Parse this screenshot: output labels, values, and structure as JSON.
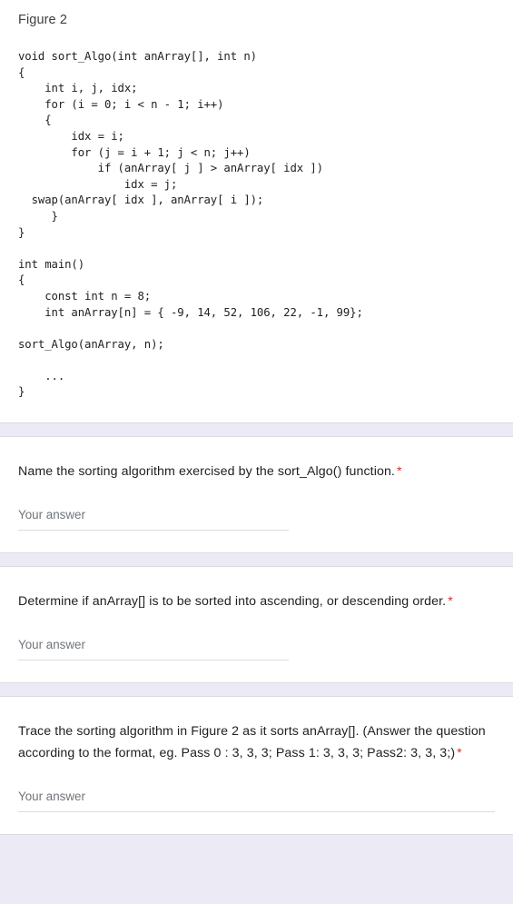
{
  "figure": {
    "title": "Figure 2",
    "code": "void sort_Algo(int anArray[], int n)\n{\n    int i, j, idx;\n    for (i = 0; i < n - 1; i++)\n    {\n        idx = i;\n        for (j = i + 1; j < n; j++)\n            if (anArray[ j ] > anArray[ idx ])\n                idx = j;\n  swap(anArray[ idx ], anArray[ i ]);\n     }\n}\n\nint main()\n{\n    const int n = 8;\n    int anArray[n] = { -9, 14, 52, 106, 22, -1, 99};\n\nsort_Algo(anArray, n);\n\n    ...\n}"
  },
  "questions": [
    {
      "text": "Name the sorting algorithm exercised by the sort_Algo() function.",
      "required_marker": "*",
      "answer_value": "",
      "answer_placeholder": "Your answer"
    },
    {
      "text": "Determine if anArray[] is to be sorted into ascending, or descending order.",
      "required_marker": "*",
      "answer_value": "",
      "answer_placeholder": "Your answer"
    },
    {
      "text": "Trace the sorting algorithm in Figure 2 as it sorts anArray[]. (Answer the question according to the format, eg. Pass 0 : 3, 3, 3; Pass 1: 3, 3, 3; Pass2: 3, 3, 3;)",
      "required_marker": "*",
      "answer_value": "",
      "answer_placeholder": "Your answer"
    }
  ],
  "colors": {
    "page_background": "#eceaf4",
    "card_background": "#ffffff",
    "required_star": "#d93025",
    "body_text": "#202124",
    "placeholder_text": "#70757a",
    "divider": "#dadce0"
  }
}
